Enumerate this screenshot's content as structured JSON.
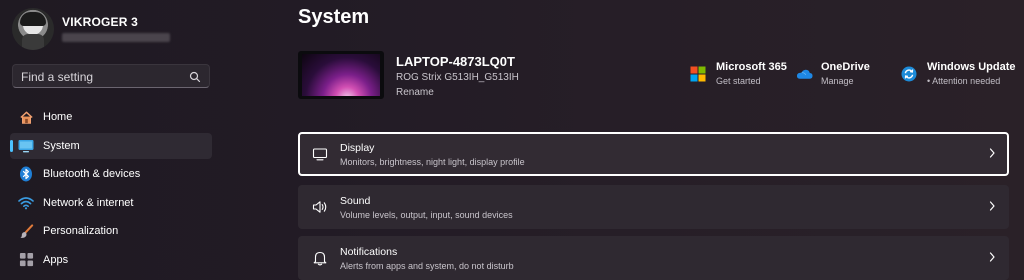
{
  "user": {
    "name": "VIKROGER 3"
  },
  "search": {
    "placeholder": "Find a setting"
  },
  "sidebar": {
    "items": [
      {
        "label": "Home",
        "icon": "home-icon"
      },
      {
        "label": "System",
        "icon": "system-icon",
        "active": true
      },
      {
        "label": "Bluetooth & devices",
        "icon": "bluetooth-icon"
      },
      {
        "label": "Network & internet",
        "icon": "wifi-icon"
      },
      {
        "label": "Personalization",
        "icon": "paintbrush-icon"
      },
      {
        "label": "Apps",
        "icon": "apps-icon"
      }
    ]
  },
  "page": {
    "title": "System"
  },
  "device": {
    "name": "LAPTOP-4873LQ0T",
    "model": "ROG Strix G513IH_G513IH",
    "rename": "Rename"
  },
  "quick_links": [
    {
      "title": "Microsoft 365",
      "subtitle": "Get started",
      "icon": "microsoft-logo-icon"
    },
    {
      "title": "OneDrive",
      "subtitle": "Manage",
      "icon": "onedrive-cloud-icon"
    },
    {
      "title": "Windows Update",
      "subtitle": "Attention needed",
      "icon": "windows-update-icon"
    }
  ],
  "cards": [
    {
      "title": "Display",
      "subtitle": "Monitors, brightness, night light, display profile",
      "icon": "display-icon"
    },
    {
      "title": "Sound",
      "subtitle": "Volume levels, output, input, sound devices",
      "icon": "speaker-icon"
    },
    {
      "title": "Notifications",
      "subtitle": "Alerts from apps and system, do not disturb",
      "icon": "bell-icon"
    }
  ],
  "colors": {
    "accent": "#4cc2ff",
    "background": "#221c24",
    "card": "#2f2931"
  }
}
